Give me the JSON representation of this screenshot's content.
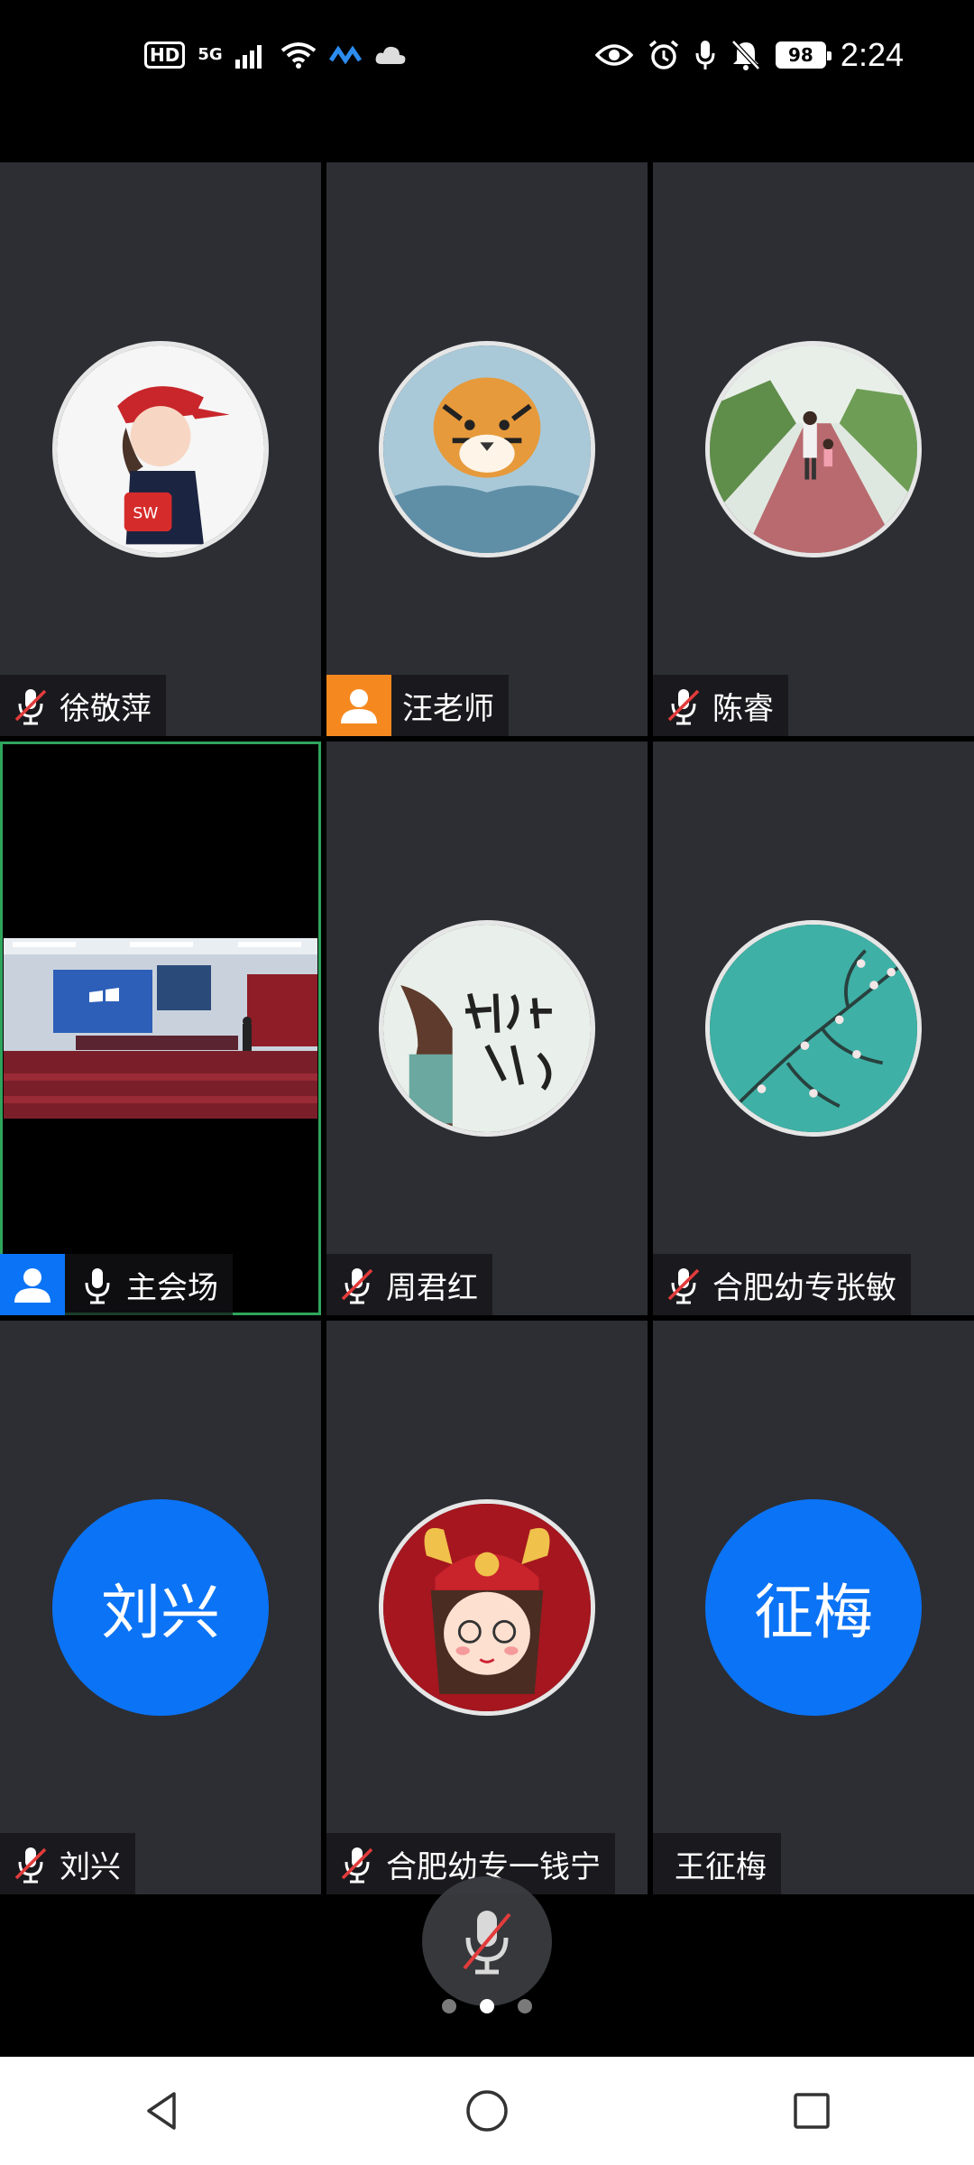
{
  "status_bar": {
    "hd": "HD",
    "network": "5G",
    "battery": "98",
    "time": "2:24"
  },
  "tiles": [
    {
      "name": "徐敬萍",
      "mic": "muted",
      "avatar": "photo-girl-red-cap"
    },
    {
      "name": "汪老师",
      "mic": "none",
      "badge": "person-orange",
      "avatar": "photo-tiger"
    },
    {
      "name": "陈睿",
      "mic": "muted",
      "avatar": "photo-path-walk"
    },
    {
      "name": "主会场",
      "mic": "on",
      "badge": "person-blue",
      "avatar": "video-conference-hall",
      "active": true
    },
    {
      "name": "周君红",
      "mic": "muted",
      "avatar": "photo-girl-calligraphy"
    },
    {
      "name": "合肥幼专张敏",
      "mic": "muted",
      "avatar": "photo-teal-blossom"
    },
    {
      "name": "刘兴",
      "mic": "muted",
      "avatar_text": "刘兴",
      "avatar_color": "#0b73f5"
    },
    {
      "name": "合肥幼专一钱宁",
      "mic": "muted",
      "avatar": "photo-ox-girl"
    },
    {
      "name": "王征梅",
      "mic": "none",
      "avatar_text": "征梅",
      "avatar_color": "#0b73f5"
    }
  ],
  "controls": {
    "mic_button_state": "muted",
    "page_dots": 3,
    "active_page": 2
  },
  "colors": {
    "tile_bg": "#2c2e33",
    "active_border": "#2fa55c",
    "accent_blue": "#0b73f5",
    "orange_badge": "#f5891f",
    "muted_red": "#e33b3b"
  }
}
